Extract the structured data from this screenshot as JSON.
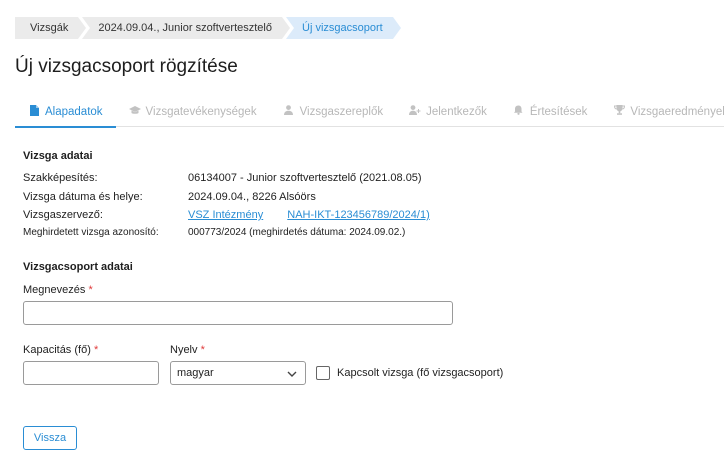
{
  "breadcrumb": [
    "Vizsgák",
    "2024.09.04., Junior szoftvertesztelő",
    "Új vizsgacsoport"
  ],
  "page_title": "Új vizsgacsoport rögzítése",
  "tabs": [
    {
      "label": "Alapadatok",
      "icon": "document-icon",
      "active": true
    },
    {
      "label": "Vizsgatevékenységek",
      "icon": "graduation-cap-icon",
      "active": false
    },
    {
      "label": "Vizsgaszereplők",
      "icon": "person-icon",
      "active": false
    },
    {
      "label": "Jelentkezők",
      "icon": "person-add-icon",
      "active": false
    },
    {
      "label": "Értesítések",
      "icon": "bell-icon",
      "active": false
    },
    {
      "label": "Vizsgaeredmények",
      "icon": "trophy-icon",
      "active": false
    }
  ],
  "exam_data": {
    "title": "Vizsga adatai",
    "qualification_label": "Szakképesítés:",
    "qualification_value": "06134007 - Junior szoftvertesztelő (2021.08.05)",
    "date_place_label": "Vizsga dátuma és helye:",
    "date_place_value": "2024.09.04., 8226 Alsóörs",
    "organizer_label": "Vizsgaszervező:",
    "organizer_link": "VSZ Intézmény",
    "organizer_id_link": "NAH-IKT-123456789/2024/1)",
    "announced_label": "Meghirdetett vizsga azonosító:",
    "announced_value": "000773/2024 (meghirdetés dátuma: 2024.09.02.)"
  },
  "group_data": {
    "title": "Vizsgacsoport adatai",
    "name_label": "Megnevezés",
    "name_value": "",
    "capacity_label": "Kapacitás (fő)",
    "capacity_value": "",
    "language_label": "Nyelv",
    "language_value": "magyar",
    "linked_label": "Kapcsolt vizsga (fő vizsgacsoport)",
    "linked_checked": false,
    "required_mark": "*"
  },
  "buttons": {
    "back": "Vissza"
  },
  "colors": {
    "accent": "#2a8dd4",
    "required": "#e03a3a"
  }
}
